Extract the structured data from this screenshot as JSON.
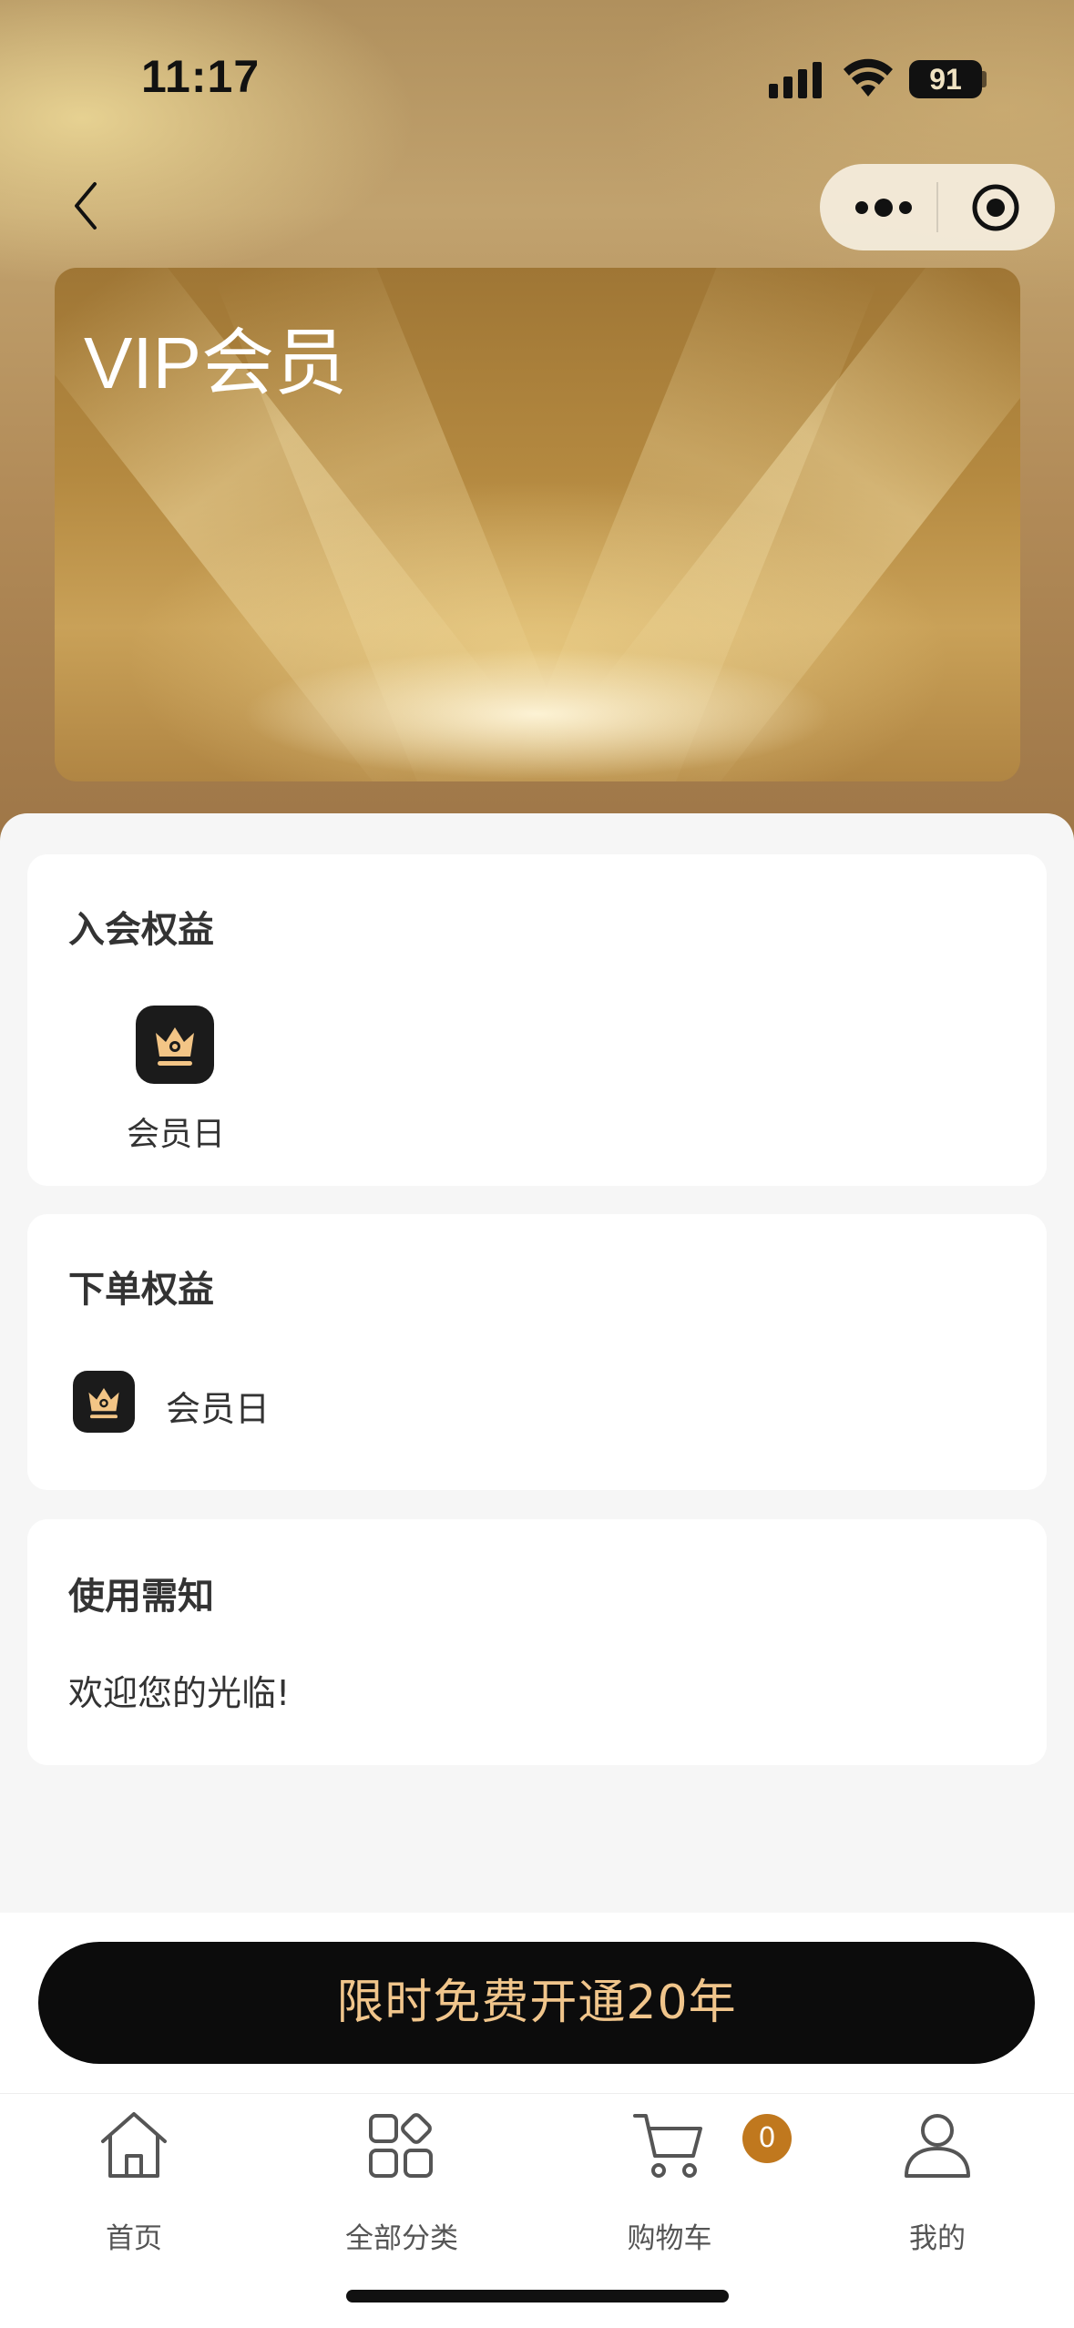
{
  "status_bar": {
    "time": "11:17",
    "battery": "91"
  },
  "header": {
    "card_title": "VIP会员"
  },
  "sections": {
    "join_benefits": {
      "title": "入会权益",
      "items": [
        {
          "label": "会员日",
          "icon": "crown-icon"
        }
      ]
    },
    "order_benefits": {
      "title": "下单权益",
      "items": [
        {
          "label": "会员日",
          "icon": "crown-icon"
        }
      ]
    },
    "notice": {
      "title": "使用需知",
      "text": "欢迎您的光临!"
    }
  },
  "cta": {
    "label": "限时免费开通20年"
  },
  "tabbar": {
    "items": [
      {
        "label": "首页",
        "icon": "home-icon"
      },
      {
        "label": "全部分类",
        "icon": "category-icon"
      },
      {
        "label": "购物车",
        "icon": "cart-icon"
      },
      {
        "label": "我的",
        "icon": "user-icon"
      }
    ],
    "cart_badge": "0"
  },
  "colors": {
    "accent_gold": "#f0c58b",
    "badge": "#c0781e",
    "cta_bg": "#0c0c0c"
  }
}
